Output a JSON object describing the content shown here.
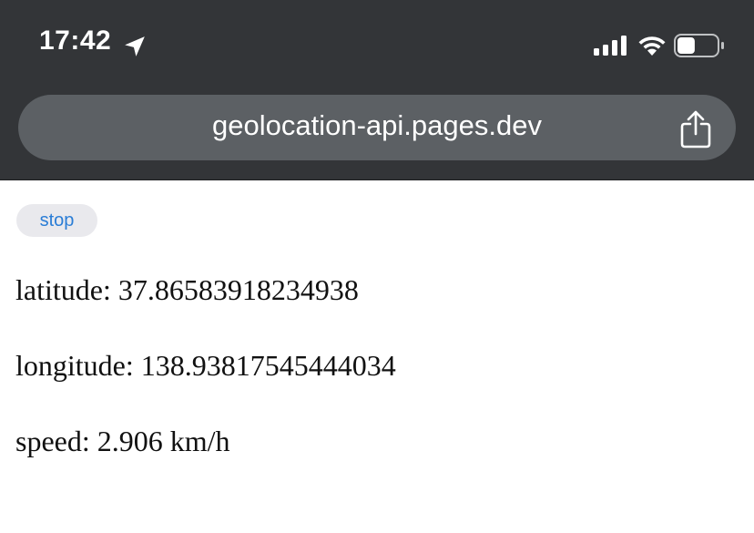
{
  "status_bar": {
    "time": "17:42",
    "location_icon": "location-arrow-icon",
    "signal_icon": "cellular-signal-icon",
    "wifi_icon": "wifi-icon",
    "battery_icon": "battery-icon",
    "battery_level": 0.45
  },
  "browser": {
    "url": "geolocation-api.pages.dev",
    "share_icon": "share-icon"
  },
  "page": {
    "stop_label": "stop",
    "latitude_text": "latitude: 37.86583918234938",
    "longitude_text": "longitude: 138.93817545444034",
    "speed_text": "speed: 2.906 km/h"
  },
  "colors": {
    "chrome_background": "#333538",
    "url_pill": "#5c6064",
    "button_background": "#e9e9ed",
    "button_text": "#2a7dd6"
  }
}
